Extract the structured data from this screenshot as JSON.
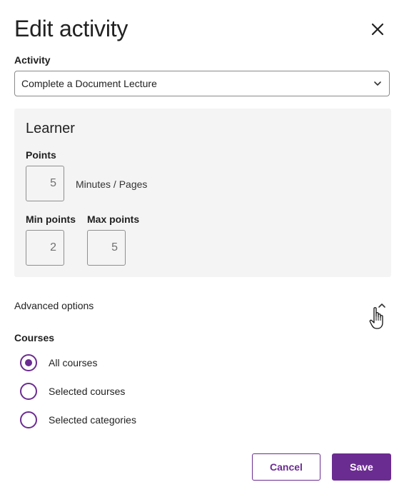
{
  "dialog": {
    "title": "Edit activity",
    "close_icon": "close-icon"
  },
  "activity": {
    "label": "Activity",
    "selected": "Complete a Document Lecture",
    "dropdown_icon": "chevron-down-icon"
  },
  "learner": {
    "heading": "Learner",
    "points_label": "Points",
    "points_value": "5",
    "points_unit": "Minutes / Pages",
    "min_points_label": "Min points",
    "min_points_value": "2",
    "max_points_label": "Max points",
    "max_points_value": "5"
  },
  "advanced": {
    "label": "Advanced options",
    "toggle_icon": "chevron-up-icon"
  },
  "courses": {
    "label": "Courses",
    "options": [
      {
        "label": "All courses",
        "checked": true
      },
      {
        "label": "Selected courses",
        "checked": false
      },
      {
        "label": "Selected categories",
        "checked": false
      }
    ]
  },
  "actions": {
    "cancel_label": "Cancel",
    "save_label": "Save"
  },
  "colors": {
    "accent": "#6b2c91",
    "panel_bg": "#f4f4f4",
    "text": "#222222"
  }
}
